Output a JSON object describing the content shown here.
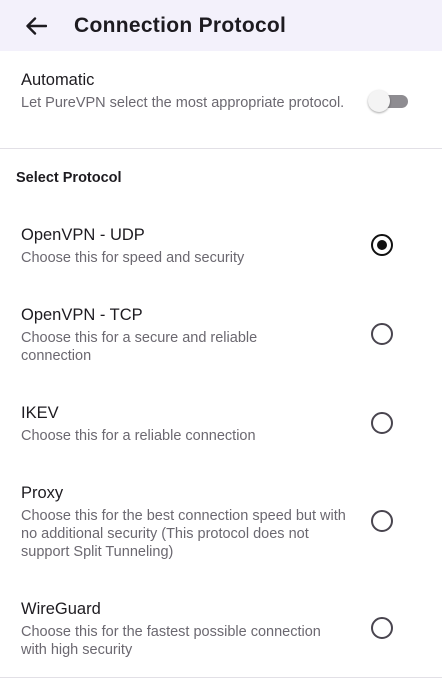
{
  "header": {
    "back_icon": "arrow-left-icon",
    "title": "Connection Protocol"
  },
  "automatic": {
    "title": "Automatic",
    "description": "Let PureVPN select the most appropriate protocol.",
    "enabled": false
  },
  "section": {
    "title": "Select Protocol"
  },
  "protocols": [
    {
      "title": "OpenVPN - UDP",
      "description": "Choose this for speed and security",
      "selected": true
    },
    {
      "title": "OpenVPN - TCP",
      "description": "Choose this for a secure and reliable connection",
      "selected": false
    },
    {
      "title": "IKEV",
      "description": "Choose this for a reliable connection",
      "selected": false
    },
    {
      "title": "Proxy",
      "description": "Choose this for the best connection speed but with no additional security (This protocol does not support Split Tunneling)",
      "selected": false
    },
    {
      "title": "WireGuard",
      "description": "Choose this for the fastest possible connection with high security",
      "selected": false
    }
  ],
  "colors": {
    "app_bar_bg": "#f3f1fb",
    "text_primary": "#1d1b20",
    "text_secondary": "#6b6870",
    "radio_selected": "#111111"
  }
}
